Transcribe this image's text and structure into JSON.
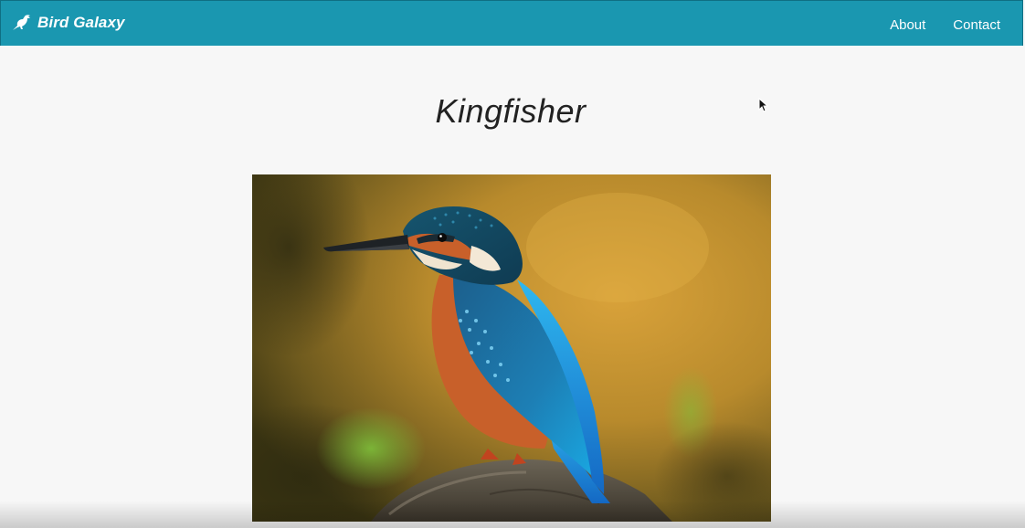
{
  "navbar": {
    "brand": {
      "name": "Bird Galaxy",
      "icon": "bird-icon"
    },
    "links": [
      {
        "label": "About"
      },
      {
        "label": "Contact"
      }
    ],
    "color": "#1a97b0"
  },
  "main": {
    "title": "Kingfisher",
    "image": {
      "subject": "kingfisher-photo"
    }
  }
}
